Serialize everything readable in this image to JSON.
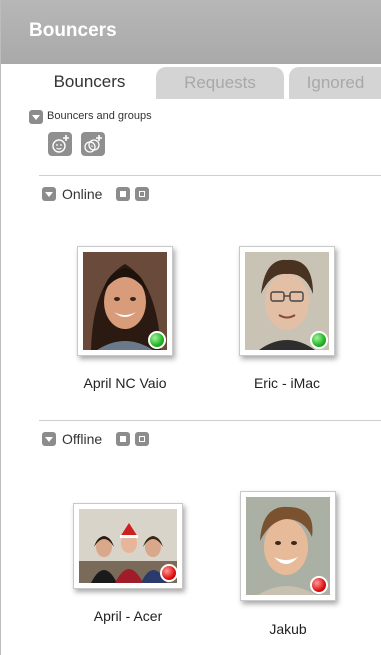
{
  "window": {
    "title": "Bouncers"
  },
  "tabs": [
    {
      "label": "Bouncers",
      "active": true
    },
    {
      "label": "Requests",
      "active": false
    },
    {
      "label": "Ignored",
      "active": false
    }
  ],
  "section": {
    "label": "Bouncers and groups",
    "actions": [
      {
        "icon": "add-user-icon"
      },
      {
        "icon": "add-group-icon"
      }
    ]
  },
  "groups": {
    "online": {
      "label": "Online",
      "members": [
        {
          "name": "April NC Vaio",
          "status": "online"
        },
        {
          "name": "Eric - iMac",
          "status": "online"
        }
      ]
    },
    "offline": {
      "label": "Offline",
      "members": [
        {
          "name": "April - Acer",
          "status": "offline"
        },
        {
          "name": "Jakub",
          "status": "offline"
        }
      ]
    }
  },
  "colors": {
    "title_bar": "#aeaeae",
    "online": "#22b322",
    "offline": "#e01010",
    "tab_inactive": "#d4d4d4"
  }
}
